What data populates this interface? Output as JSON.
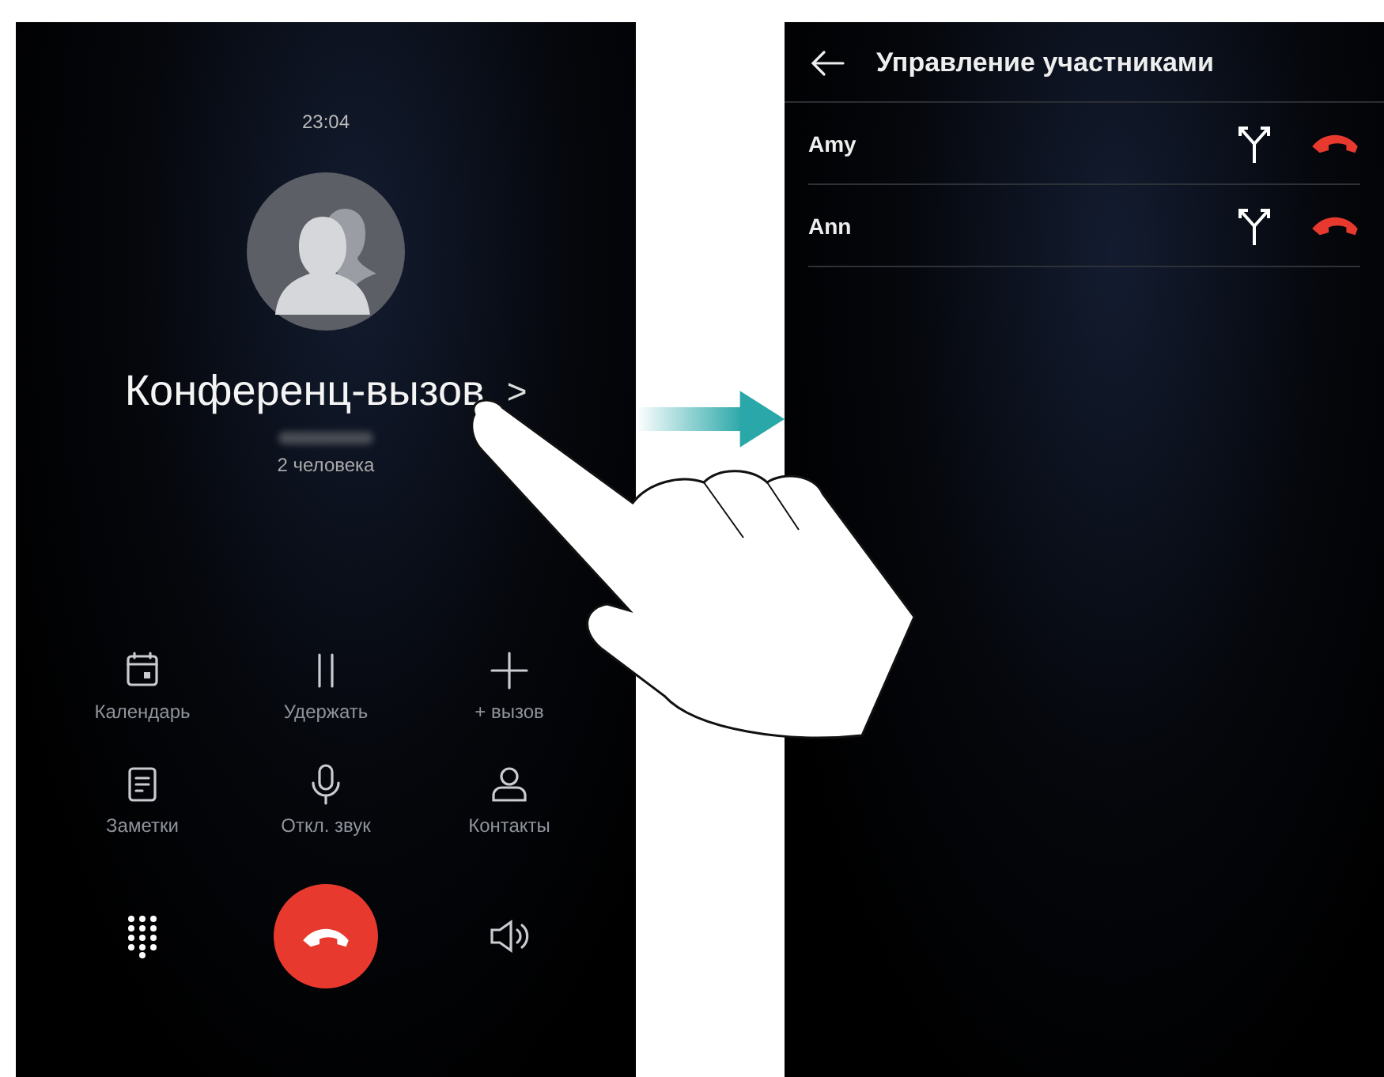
{
  "call_screen": {
    "time": "23:04",
    "title": "Конференц-вызов",
    "chevron": ">",
    "subtitle": "2 человека",
    "actions": [
      {
        "label": "Календарь"
      },
      {
        "label": "Удержать"
      },
      {
        "label": "+ вызов"
      },
      {
        "label": "Заметки"
      },
      {
        "label": "Откл. звук"
      },
      {
        "label": "Контакты"
      }
    ]
  },
  "participants_screen": {
    "title": "Управление участниками",
    "participants": [
      {
        "name": "Amy"
      },
      {
        "name": "Ann"
      }
    ]
  }
}
